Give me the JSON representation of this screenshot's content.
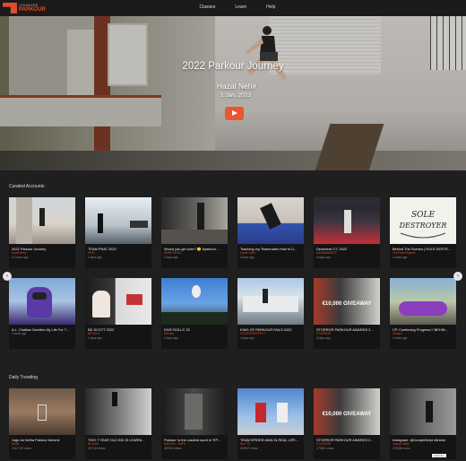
{
  "header": {
    "logo_line1": "YOUNGER",
    "logo_line2": "PARKOUR",
    "nav": [
      "Classes",
      "Learn",
      "Help"
    ]
  },
  "hero": {
    "title": "2022 Parkour Journey",
    "author": "Hazal Nehir",
    "date": "1 Jan, 2023",
    "play_icon": "play-icon"
  },
  "curated": {
    "title": "Curated Accounts",
    "rows": [
      [
        {
          "title": "2022 Parkour Journey",
          "author": "Hazal Nehir",
          "date": "11 hours ago"
        },
        {
          "title": "TEAM PHAT 2022",
          "author": "PHAT",
          "date": "2 days ago"
        },
        {
          "title": "Would you get over? 😳 #parkour ...",
          "author": "EMRE NOSC",
          "date": "3 days ago"
        },
        {
          "title": "Teaching my Teammates How to D...",
          "author": "Lynne Chris",
          "date": "4 days ago"
        },
        {
          "title": "December 27, 2022",
          "author": "MAXIMANIACS",
          "date": "5 days ago"
        },
        {
          "title": "Behind The Scenes | SOLE DESTR...",
          "author": "The Phat Projects",
          "date": "1 week ago"
        }
      ],
      [
        {
          "title": "A.L. Chalkax Decides My Life For 7...",
          "author": "",
          "date": "1 week ago"
        },
        {
          "title": "BD SCOTT 2022",
          "author": "BD Scott",
          "date": "2 days ago"
        },
        {
          "title": "DIVE ROLLS '22",
          "author": "Damian",
          "date": "3 days ago"
        },
        {
          "title": "KING OF PARKOUR FAILS 2022",
          "author": "COUNTEREFFECT",
          "date": "4 days ago"
        },
        {
          "title": "STORROR PARKOUR AWARDS 2...",
          "author": "STORROR",
          "date": "5 days ago",
          "overlay": "€10,000 GIVEAWAY"
        },
        {
          "title": "CP. Continuing Progress !! BEHIN...",
          "author": "Chrisbu",
          "date": "1 week ago"
        }
      ]
    ]
  },
  "trending": {
    "title": "Daily Trending",
    "items": [
      {
        "title": "Jogo do Nelha Parkour #shortz",
        "author": "Nelha",
        "date": "1513 119 views"
      },
      {
        "title": "THIS 7 YEAR OLD KID IS LEARNI...",
        "author": "Bd Scott",
        "date": "457746 views"
      },
      {
        "title": "Parkour' is the craziest sport in 'EP...",
        "author": "Nahi Fuh - SDPK",
        "date": "387964 views"
      },
      {
        "title": "TEAM SPIDER-MAN IN REAL LIFE...",
        "author": "NoU TV",
        "date": "319907 views"
      },
      {
        "title": "STORROR PARKOUR AWARDS 2...",
        "author": "STORROR",
        "date": "277881 views",
        "overlay": "€10,000 GIVEAWAY"
      },
      {
        "title": "Instagram: @JumperNelpi #shortz",
        "author": "Joseph Nelpi",
        "date": "279838 views"
      }
    ]
  },
  "controls": {
    "prev_icon": "chevron-left-icon",
    "next_icon": "chevron-right-icon",
    "scroll_label": "SCROLL"
  },
  "colors": {
    "accent": "#e04b2a",
    "background": "#1f1f1f",
    "card_meta": "#141414"
  }
}
